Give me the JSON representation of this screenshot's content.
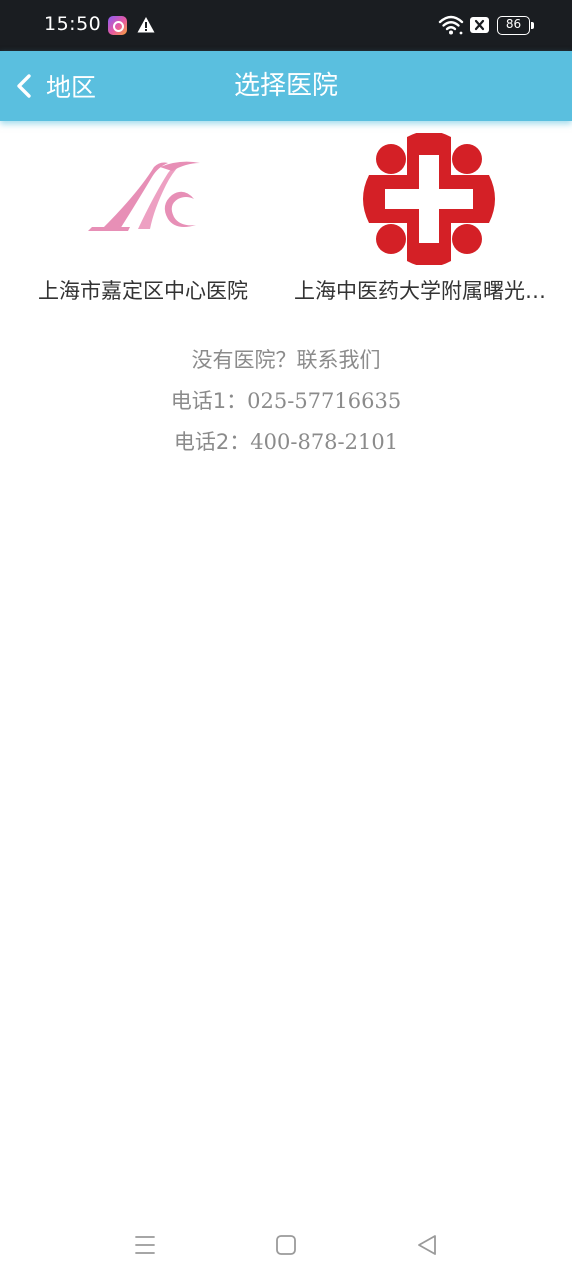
{
  "status_bar": {
    "time": "15:50",
    "battery_level": "86",
    "icons": [
      "app-notification-icon",
      "warning-icon",
      "wifi-icon",
      "sim-disabled-icon",
      "battery-icon"
    ]
  },
  "header": {
    "back_label": "地区",
    "title": "选择医院",
    "background_color": "#5abfdf"
  },
  "hospitals": [
    {
      "name": "上海市嘉定区中心医院",
      "logo": "jiading-hospital-logo"
    },
    {
      "name": "上海中医药大学附属曙光医院",
      "logo": "red-cross-logo"
    }
  ],
  "contact": {
    "prompt": "没有医院？联系我们",
    "phone1_label": "电话1：",
    "phone1": "025-57716635",
    "phone2_label": "电话2：",
    "phone2": "400-878-2101"
  },
  "nav_bar": {
    "icons": [
      "menu-icon",
      "home-icon",
      "back-triangle-icon"
    ]
  }
}
